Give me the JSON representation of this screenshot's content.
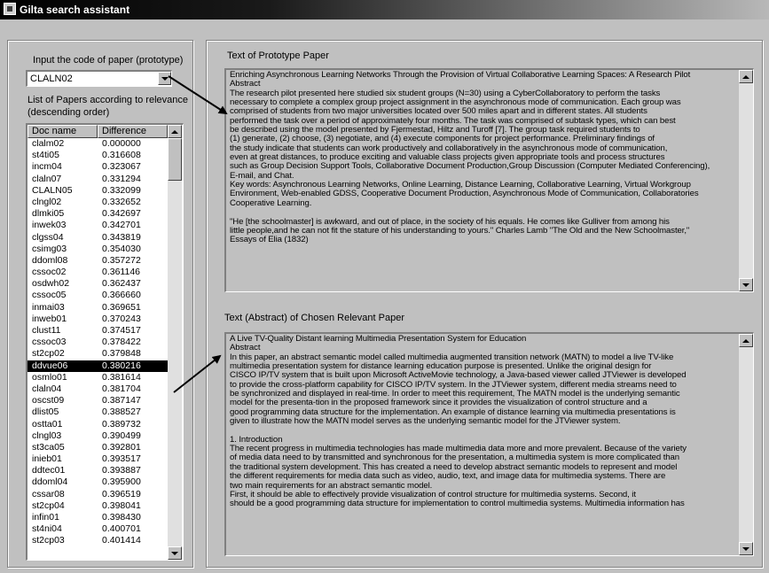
{
  "window": {
    "title": "Gilta search assistant"
  },
  "left_panel": {
    "code_label": "Input the code of paper (prototype)",
    "code_value": "CLALN02",
    "list_label_line1": "List of Papers according to relevance",
    "list_label_line2": "(descending order)",
    "columns": [
      "Doc name",
      "Difference"
    ],
    "selected_index": 19,
    "rows": [
      [
        "clalm02",
        "0.000000"
      ],
      [
        "st4ti05",
        "0.316608"
      ],
      [
        "incm04",
        "0.323067"
      ],
      [
        "claln07",
        "0.331294"
      ],
      [
        "CLALN05",
        "0.332099"
      ],
      [
        "clngl02",
        "0.332652"
      ],
      [
        "dlmki05",
        "0.342697"
      ],
      [
        "inwek03",
        "0.342701"
      ],
      [
        "clgss04",
        "0.343819"
      ],
      [
        "csimg03",
        "0.354030"
      ],
      [
        "ddoml08",
        "0.357272"
      ],
      [
        "cssoc02",
        "0.361146"
      ],
      [
        "osdwh02",
        "0.362437"
      ],
      [
        "cssoc05",
        "0.366660"
      ],
      [
        "inmai03",
        "0.369651"
      ],
      [
        "inweb01",
        "0.370243"
      ],
      [
        "clust11",
        "0.374517"
      ],
      [
        "cssoc03",
        "0.378422"
      ],
      [
        "st2cp02",
        "0.379848"
      ],
      [
        "ddvue06",
        "0.380216"
      ],
      [
        "osmlo01",
        "0.381614"
      ],
      [
        "claln04",
        "0.381704"
      ],
      [
        "oscst09",
        "0.387147"
      ],
      [
        "dlist05",
        "0.388527"
      ],
      [
        "ostta01",
        "0.389732"
      ],
      [
        "clngl03",
        "0.390499"
      ],
      [
        "st3ca05",
        "0.392801"
      ],
      [
        "inieb01",
        "0.393517"
      ],
      [
        "ddtec01",
        "0.393887"
      ],
      [
        "ddoml04",
        "0.395900"
      ],
      [
        "cssar08",
        "0.396519"
      ],
      [
        "st2cp04",
        "0.398041"
      ],
      [
        "infin01",
        "0.398430"
      ],
      [
        "st4ni04",
        "0.400701"
      ],
      [
        "st2cp03",
        "0.401414"
      ]
    ]
  },
  "prototype_panel": {
    "title": "Text of Prototype Paper",
    "text": "Enriching Asynchronous Learning Networks Through the Provision of Virtual Collaborative Learning Spaces: A Research Pilot\nAbstract\nThe research pilot presented here studied six student groups (N=30) using a CyberCollaboratory to perform the tasks\nnecessary to complete a complex group project assignment in the asynchronous mode of communication. Each group was\ncomprised of students from two major universities located over 500 miles apart and in different states. All students\nperformed the task over a period of approximately four months. The task was comprised of subtask types, which can best\nbe described using the model presented by Fjermestad, Hiltz and Turoff [7]. The group task required students to\n(1) generate, (2) choose, (3) negotiate, and (4) execute components for project performance. Preliminary findings of\nthe study indicate that students can work productively and collaboratively in the asynchronous mode of communication,\neven at great distances, to produce exciting and valuable class projects given appropriate tools and process structures\nsuch as Group Decision Support Tools, Collaborative Document Production,Group Discussion (Computer Mediated Conferencing),\nE-mail, and Chat.\nKey words: Asynchronous Learning Networks, Online Learning, Distance Learning, Collaborative Learning, Virtual Workgroup\nEnvironment, Web-enabled GDSS, Cooperative Document Production, Asynchronous Mode of Communication, Collaboratories\nCooperative Learning.\n\n\"He [the schoolmaster] is awkward, and out of place, in the society of his equals. He comes like Gulliver from among his\nlittle people,and he can not fit the stature of his understanding to yours.\" Charles Lamb \"The Old and the New Schoolmaster,\"\nEssays of Elia (1832)"
  },
  "chosen_panel": {
    "title": "Text (Abstract) of Chosen Relevant Paper",
    "text": "A Live TV-Quality Distant learning Multimedia Presentation System for Education\nAbstract\nIn this paper, an abstract semantic model called multimedia augmented transition network (MATN) to model a live TV-like\nmultimedia presentation system for distance learning education purpose is presented. Unlike the original design for\nCISCO IP/TV system that is built upon Microsoft ActiveMovie technology, a Java-based viewer called JTViewer is developed\nto provide the cross-platform capability for CISCO IP/TV system. In the JTViewer system, different media streams need to\nbe synchronized and displayed in real-time. In order to meet this requirement, The MATN model is the underlying semantic\nmodel for the presenta-tion in the proposed framework since it provides the visualization of control structure and a\ngood programming data structure for the implementation. An example of distance learning via multimedia presentations is\ngiven to illustrate how the MATN model serves as the underlying semantic model for the JTViewer system.\n\n1. Introduction\nThe recent progress in multimedia technologies has made multimedia data more and more prevalent. Because of the variety\nof media data need to by transmitted and synchronous for the presentation, a multimedia system is more complicated than\nthe traditional system development. This has created a need to develop abstract semantic models to represent and model\nthe different requirements for media data such as video, audio, text, and image data for multimedia systems. There are\ntwo main requirements for an abstract semantic model.\nFirst, it should be able to effectively provide visualization of control structure for multimedia systems. Second, it\nshould be a good programming data structure for implementation to control multimedia systems. Multimedia information has"
  },
  "colors": {
    "selection": "#000000",
    "window_bg": "#c0c0c0"
  }
}
